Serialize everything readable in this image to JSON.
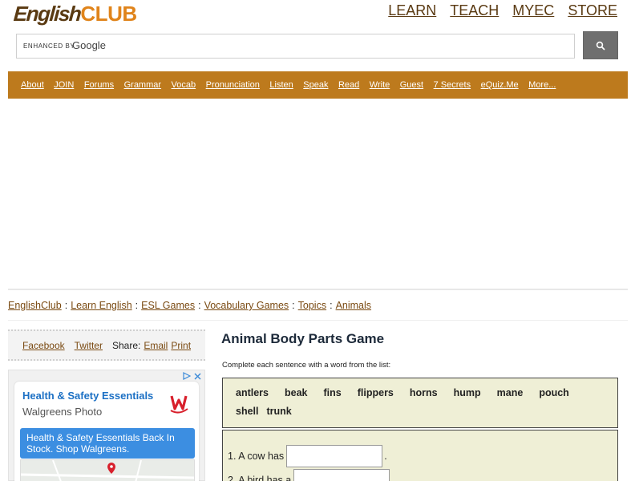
{
  "header": {
    "logo_part1": "English",
    "logo_part2": "CLUB",
    "topnav": [
      "LEARN",
      "TEACH",
      "MYEC",
      "STORE"
    ]
  },
  "search": {
    "enhanced_label": "ENHANCED BY",
    "google_label": "Google",
    "button_icon": "search-icon"
  },
  "navbar": {
    "items": [
      "About",
      "JOIN",
      "Forums",
      "Grammar",
      "Vocab",
      "Pronunciation",
      "Listen",
      "Speak",
      "Read",
      "Write",
      "Guest",
      "7 Secrets",
      "eQuiz.Me",
      "More..."
    ],
    "bg_color": "#bd7a1d"
  },
  "breadcrumb": {
    "items": [
      "EnglishClub",
      "Learn English",
      "ESL Games",
      "Vocabulary Games",
      "Topics",
      "Animals"
    ],
    "separator": ":"
  },
  "share": {
    "facebook": "Facebook",
    "twitter": "Twitter",
    "label": "Share:",
    "email": "Email",
    "print": "Print"
  },
  "ad": {
    "title": "Health & Safety Essentials",
    "subtitle": "Walgreens Photo",
    "banner": "Health & Safety Essentials Back In Stock. Shop Walgreens.",
    "logo_icon": "walgreens-logo-icon",
    "adchoices_icon": "ad-info-icon",
    "close_icon": "close-icon"
  },
  "game": {
    "title": "Animal Body Parts Game",
    "instructions": "Complete each sentence with a word from the list:",
    "words": [
      "antlers",
      "beak",
      "fins",
      "flippers",
      "horns",
      "hump",
      "mane",
      "pouch",
      "shell",
      "trunk"
    ],
    "questions": [
      {
        "before": "1. A cow has",
        "after": "."
      },
      {
        "before": "2. A bird has a",
        "after": ""
      }
    ]
  }
}
